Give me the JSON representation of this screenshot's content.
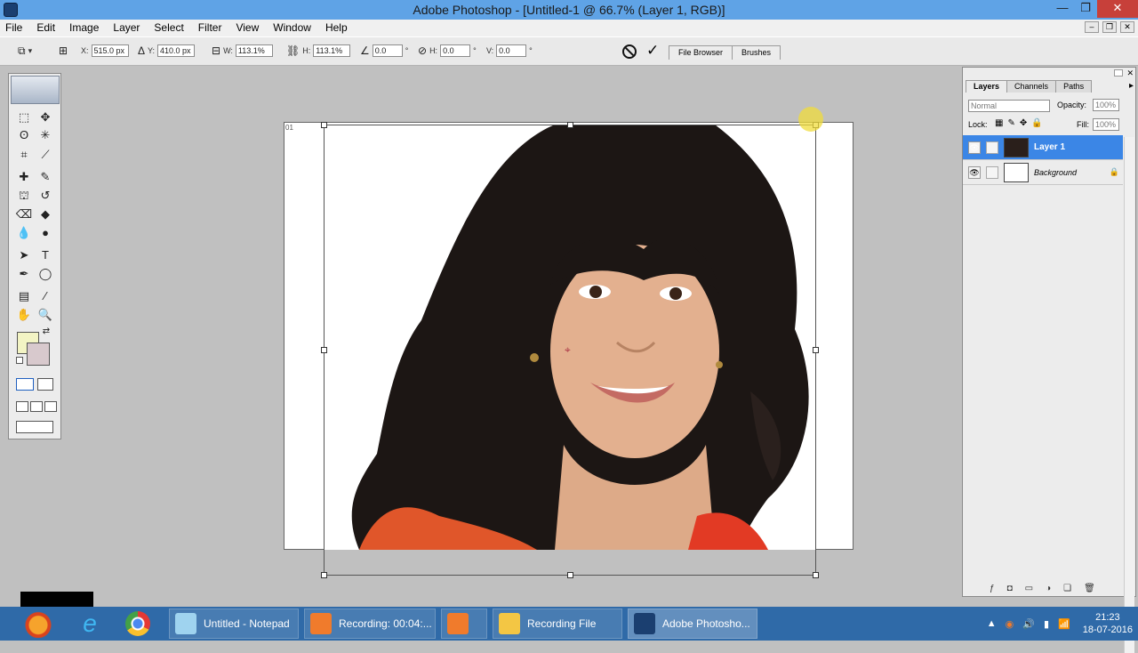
{
  "window": {
    "title": "Adobe Photoshop - [Untitled-1 @ 66.7% (Layer 1, RGB)]",
    "min": "—",
    "max": "❐",
    "close": "✕"
  },
  "menu": [
    "File",
    "Edit",
    "Image",
    "Layer",
    "Select",
    "Filter",
    "View",
    "Window",
    "Help"
  ],
  "options": {
    "x_label": "X:",
    "x_value": "515.0 px",
    "y_label": "Y:",
    "y_value": "410.0 px",
    "w_label": "W:",
    "w_value": "113.1%",
    "h_label": "H:",
    "h_value": "113.1%",
    "rot_value": "0.0",
    "hskew_label": "H:",
    "hskew_value": "0.0",
    "vskew_label": "V:",
    "vskew_value": "0.0",
    "degree": "°"
  },
  "well_tabs": [
    "File Browser",
    "Brushes"
  ],
  "canvas": {
    "marker": "01"
  },
  "layers_panel": {
    "tabs": [
      "Layers",
      "Channels",
      "Paths"
    ],
    "blend_mode": "Normal",
    "opacity_label": "Opacity:",
    "opacity_value": "100%",
    "lock_label": "Lock:",
    "fill_label": "Fill:",
    "fill_value": "100%",
    "layers": [
      {
        "name": "Layer 1",
        "selected": true
      },
      {
        "name": "Background",
        "selected": false
      }
    ]
  },
  "taskbar": {
    "tasks": [
      {
        "label": "Untitled - Notepad"
      },
      {
        "label": "Recording:  00:04:..."
      },
      {
        "label": ""
      },
      {
        "label": "Recording File"
      },
      {
        "label": "Adobe Photosho..."
      }
    ],
    "time": "21:23",
    "date": "18-07-2016"
  },
  "colors": {
    "foreground": "#f3f4c4",
    "background": "#d8c9cd",
    "selection": "#3b86e6",
    "taskbar": "#2f6aa8"
  }
}
